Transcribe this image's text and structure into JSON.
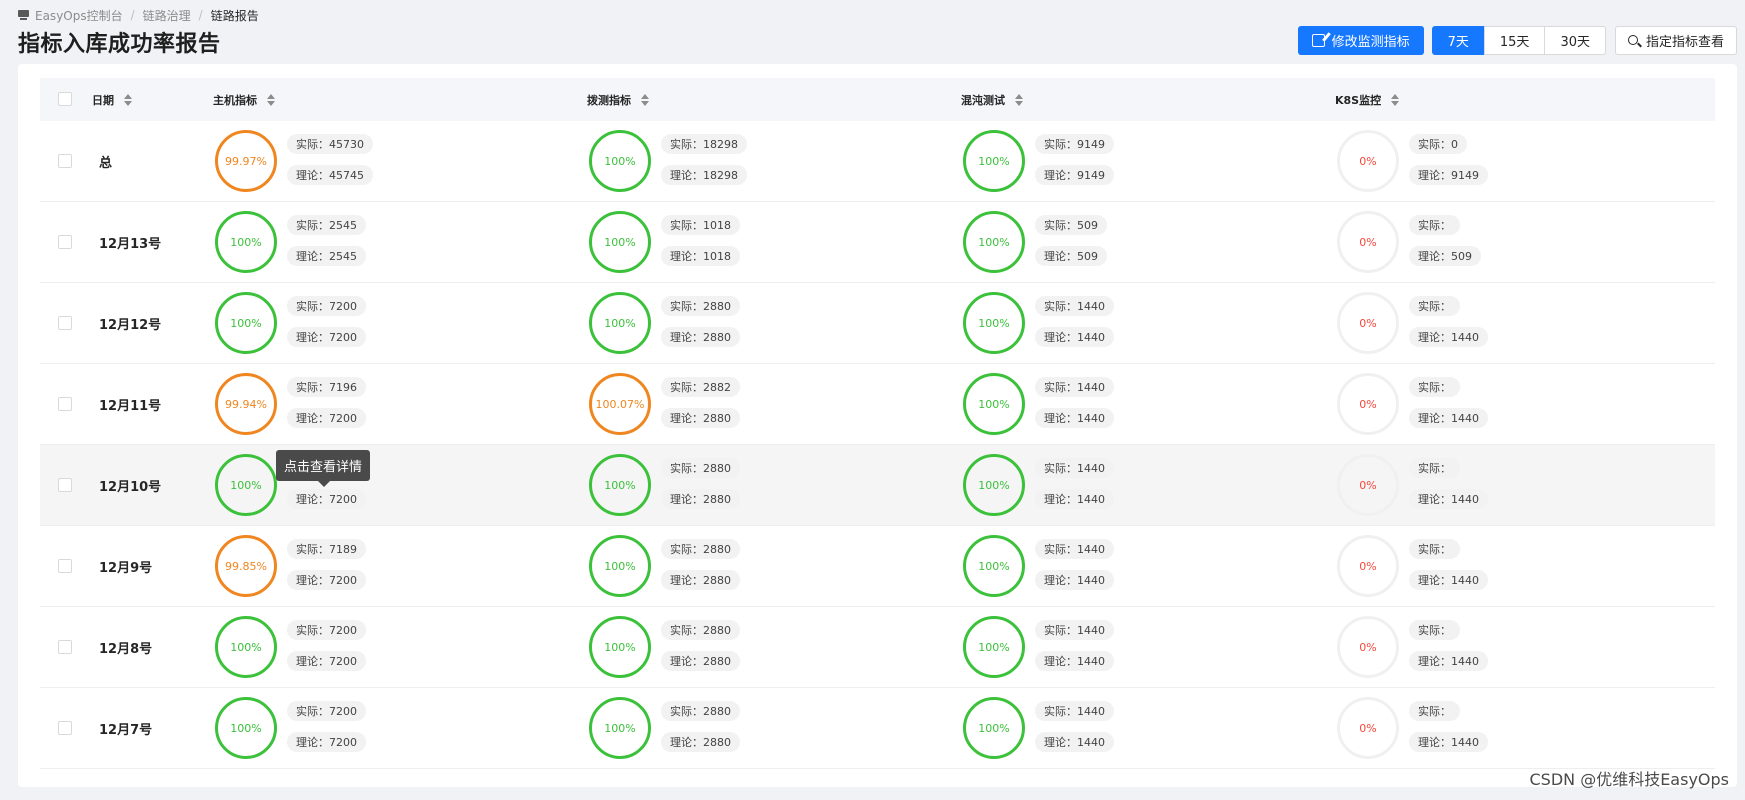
{
  "breadcrumb": {
    "items": [
      "EasyOps控制台",
      "链路治理",
      "链路报告"
    ],
    "separator": "/"
  },
  "page_title": "指标入库成功率报告",
  "toolbar": {
    "edit_label": "修改监测指标",
    "ranges": [
      "7天",
      "15天",
      "30天"
    ],
    "active_range": "7天",
    "query_label": "指定指标查看"
  },
  "columns": [
    "日期",
    "主机指标",
    "拨测指标",
    "混沌测试",
    "K8S监控"
  ],
  "rows": [
    {
      "date": "总",
      "cells": [
        {
          "rate": "99.97%",
          "status": "orange",
          "actual": "实际：45730",
          "theory": "理论：45745"
        },
        {
          "rate": "100%",
          "status": "green",
          "actual": "实际：18298",
          "theory": "理论：18298"
        },
        {
          "rate": "100%",
          "status": "green",
          "actual": "实际：9149",
          "theory": "理论：9149"
        },
        {
          "rate": "0%",
          "status": "zero",
          "actual": "实际：0",
          "theory": "理论：9149"
        }
      ]
    },
    {
      "date": "12月13号",
      "cells": [
        {
          "rate": "100%",
          "status": "green",
          "actual": "实际：2545",
          "theory": "理论：2545"
        },
        {
          "rate": "100%",
          "status": "green",
          "actual": "实际：1018",
          "theory": "理论：1018"
        },
        {
          "rate": "100%",
          "status": "green",
          "actual": "实际：509",
          "theory": "理论：509"
        },
        {
          "rate": "0%",
          "status": "zero",
          "actual": "实际：",
          "theory": "理论：509"
        }
      ]
    },
    {
      "date": "12月12号",
      "cells": [
        {
          "rate": "100%",
          "status": "green",
          "actual": "实际：7200",
          "theory": "理论：7200"
        },
        {
          "rate": "100%",
          "status": "green",
          "actual": "实际：2880",
          "theory": "理论：2880"
        },
        {
          "rate": "100%",
          "status": "green",
          "actual": "实际：1440",
          "theory": "理论：1440"
        },
        {
          "rate": "0%",
          "status": "zero",
          "actual": "实际：",
          "theory": "理论：1440"
        }
      ]
    },
    {
      "date": "12月11号",
      "cells": [
        {
          "rate": "99.94%",
          "status": "orange",
          "actual": "实际：7196",
          "theory": "理论：7200"
        },
        {
          "rate": "100.07%",
          "status": "orange",
          "actual": "实际：2882",
          "theory": "理论：2880"
        },
        {
          "rate": "100%",
          "status": "green",
          "actual": "实际：1440",
          "theory": "理论：1440"
        },
        {
          "rate": "0%",
          "status": "zero",
          "actual": "实际：",
          "theory": "理论：1440"
        }
      ]
    },
    {
      "date": "12月10号",
      "hover": true,
      "cells": [
        {
          "rate": "100%",
          "status": "green",
          "actual": "",
          "theory": "理论：7200"
        },
        {
          "rate": "100%",
          "status": "green",
          "actual": "实际：2880",
          "theory": "理论：2880"
        },
        {
          "rate": "100%",
          "status": "green",
          "actual": "实际：1440",
          "theory": "理论：1440"
        },
        {
          "rate": "0%",
          "status": "zero",
          "actual": "实际：",
          "theory": "理论：1440"
        }
      ]
    },
    {
      "date": "12月9号",
      "cells": [
        {
          "rate": "99.85%",
          "status": "orange",
          "actual": "实际：7189",
          "theory": "理论：7200"
        },
        {
          "rate": "100%",
          "status": "green",
          "actual": "实际：2880",
          "theory": "理论：2880"
        },
        {
          "rate": "100%",
          "status": "green",
          "actual": "实际：1440",
          "theory": "理论：1440"
        },
        {
          "rate": "0%",
          "status": "zero",
          "actual": "实际：",
          "theory": "理论：1440"
        }
      ]
    },
    {
      "date": "12月8号",
      "cells": [
        {
          "rate": "100%",
          "status": "green",
          "actual": "实际：7200",
          "theory": "理论：7200"
        },
        {
          "rate": "100%",
          "status": "green",
          "actual": "实际：2880",
          "theory": "理论：2880"
        },
        {
          "rate": "100%",
          "status": "green",
          "actual": "实际：1440",
          "theory": "理论：1440"
        },
        {
          "rate": "0%",
          "status": "zero",
          "actual": "实际：",
          "theory": "理论：1440"
        }
      ]
    },
    {
      "date": "12月7号",
      "cells": [
        {
          "rate": "100%",
          "status": "green",
          "actual": "实际：7200",
          "theory": "理论：7200"
        },
        {
          "rate": "100%",
          "status": "green",
          "actual": "实际：2880",
          "theory": "理论：2880"
        },
        {
          "rate": "100%",
          "status": "green",
          "actual": "实际：1440",
          "theory": "理论：1440"
        },
        {
          "rate": "0%",
          "status": "zero",
          "actual": "实际：",
          "theory": "理论：1440"
        }
      ]
    }
  ],
  "tooltip": "点击查看详情",
  "watermark": "CSDN @优维科技EasyOps",
  "colors": {
    "primary": "#1677ff",
    "success": "#3cc13b",
    "warning": "#ef8620",
    "error": "#f5483b"
  }
}
